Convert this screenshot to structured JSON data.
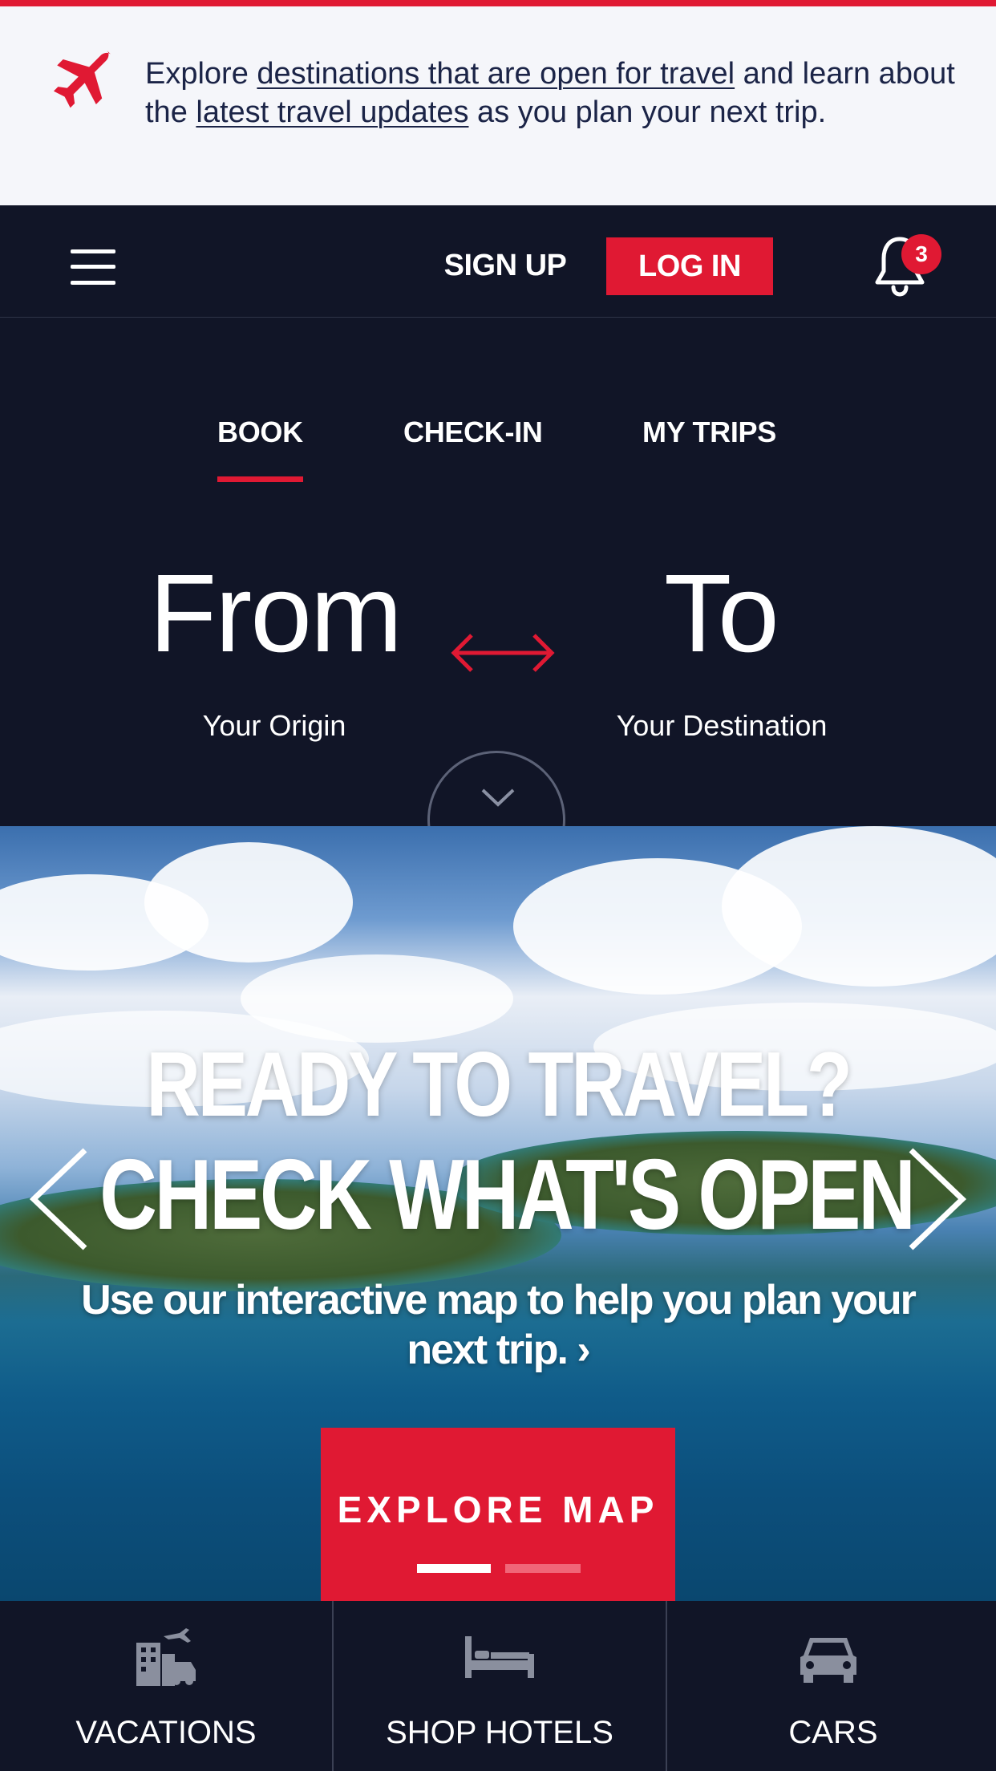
{
  "alert": {
    "prefix": "Explore ",
    "link1": "destinations that are open for travel",
    "middle": " and learn about the ",
    "link2": "latest travel updates",
    "suffix": " as you plan your next trip.",
    "icon": "airplane-icon"
  },
  "header": {
    "menu_icon": "hamburger-menu-icon",
    "signup_label": "SIGN UP",
    "login_label": "LOG IN",
    "notifications_icon": "bell-icon",
    "notification_count": "3"
  },
  "booking": {
    "tabs": [
      {
        "label": "BOOK",
        "active": true
      },
      {
        "label": "CHECK-IN",
        "active": false
      },
      {
        "label": "MY TRIPS",
        "active": false
      }
    ],
    "from_label": "From",
    "from_placeholder": "Your Origin",
    "to_label": "To",
    "to_placeholder": "Your Destination",
    "swap_icon": "swap-arrows-icon",
    "expand_icon": "chevron-down-icon"
  },
  "hero": {
    "title_line1": "READY TO TRAVEL?",
    "title_line2": "CHECK WHAT'S OPEN",
    "subtitle": "Use our interactive map to help you plan your next trip. ›",
    "cta_label": "EXPLORE MAP",
    "slide_index": 1,
    "slide_count": 2
  },
  "bottom_nav": [
    {
      "label": "VACATIONS",
      "icon": "vacation-building-icon"
    },
    {
      "label": "SHOP HOTELS",
      "icon": "bed-icon"
    },
    {
      "label": "CARS",
      "icon": "car-icon"
    }
  ],
  "colors": {
    "accent": "#e01933",
    "navy": "#111527",
    "banner_bg": "#f5f6fa",
    "banner_text": "#1b2447"
  }
}
